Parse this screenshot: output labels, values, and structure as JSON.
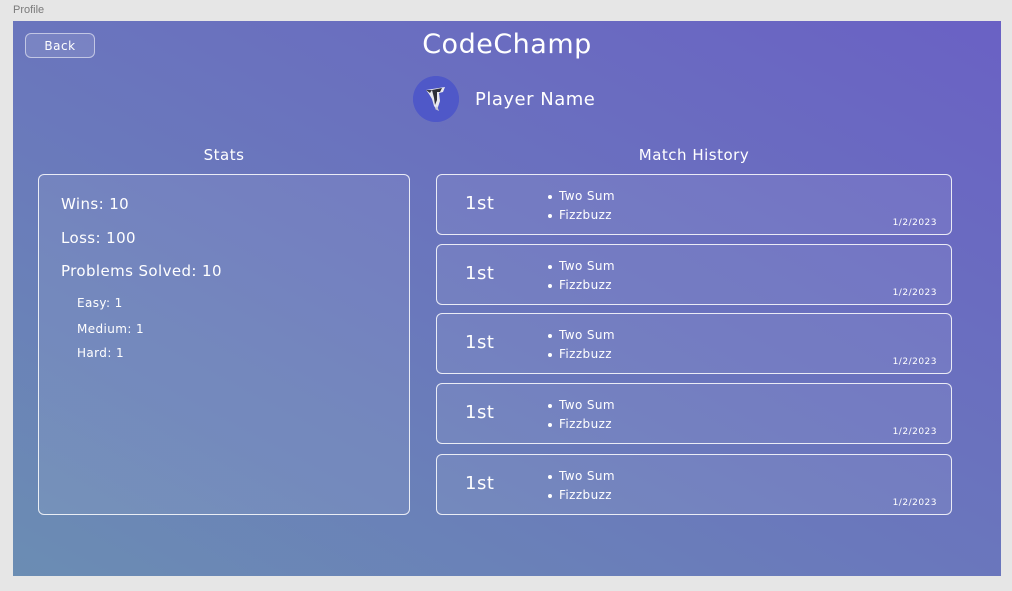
{
  "frame": {
    "label": "Profile"
  },
  "header": {
    "back_label": "Back",
    "app_title": "CodeChamp",
    "player_name": "Player Name"
  },
  "stats": {
    "title": "Stats",
    "wins": "Wins: 10",
    "loss": "Loss: 100",
    "problems_solved": "Problems Solved: 10",
    "easy": "Easy: 1",
    "medium": "Medium: 1",
    "hard": "Hard: 1"
  },
  "history": {
    "title": "Match History",
    "matches": [
      {
        "place": "1st",
        "problems": [
          "Two Sum",
          "Fizzbuzz"
        ],
        "date": "1/2/2023"
      },
      {
        "place": "1st",
        "problems": [
          "Two Sum",
          "Fizzbuzz"
        ],
        "date": "1/2/2023"
      },
      {
        "place": "1st",
        "problems": [
          "Two Sum",
          "Fizzbuzz"
        ],
        "date": "1/2/2023"
      },
      {
        "place": "1st",
        "problems": [
          "Two Sum",
          "Fizzbuzz"
        ],
        "date": "1/2/2023"
      },
      {
        "place": "1st",
        "problems": [
          "Two Sum",
          "Fizzbuzz"
        ],
        "date": "1/2/2023"
      }
    ]
  },
  "colors": {
    "gradient_start": "#6b8db3",
    "gradient_end": "#6a61c4",
    "avatar_bg": "#4f58c8"
  },
  "icons": {
    "avatar": "bird-avatar-icon"
  }
}
